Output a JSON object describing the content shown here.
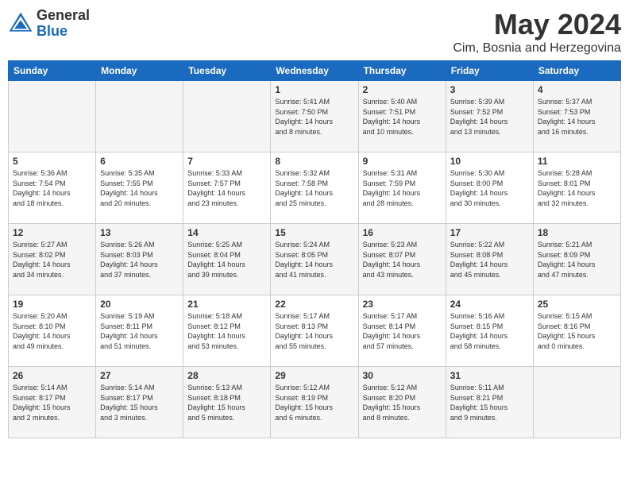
{
  "header": {
    "logo_general": "General",
    "logo_blue": "Blue",
    "month_title": "May 2024",
    "location": "Cim, Bosnia and Herzegovina"
  },
  "days_of_week": [
    "Sunday",
    "Monday",
    "Tuesday",
    "Wednesday",
    "Thursday",
    "Friday",
    "Saturday"
  ],
  "weeks": [
    [
      {
        "day": "",
        "info": ""
      },
      {
        "day": "",
        "info": ""
      },
      {
        "day": "",
        "info": ""
      },
      {
        "day": "1",
        "info": "Sunrise: 5:41 AM\nSunset: 7:50 PM\nDaylight: 14 hours\nand 8 minutes."
      },
      {
        "day": "2",
        "info": "Sunrise: 5:40 AM\nSunset: 7:51 PM\nDaylight: 14 hours\nand 10 minutes."
      },
      {
        "day": "3",
        "info": "Sunrise: 5:39 AM\nSunset: 7:52 PM\nDaylight: 14 hours\nand 13 minutes."
      },
      {
        "day": "4",
        "info": "Sunrise: 5:37 AM\nSunset: 7:53 PM\nDaylight: 14 hours\nand 16 minutes."
      }
    ],
    [
      {
        "day": "5",
        "info": "Sunrise: 5:36 AM\nSunset: 7:54 PM\nDaylight: 14 hours\nand 18 minutes."
      },
      {
        "day": "6",
        "info": "Sunrise: 5:35 AM\nSunset: 7:55 PM\nDaylight: 14 hours\nand 20 minutes."
      },
      {
        "day": "7",
        "info": "Sunrise: 5:33 AM\nSunset: 7:57 PM\nDaylight: 14 hours\nand 23 minutes."
      },
      {
        "day": "8",
        "info": "Sunrise: 5:32 AM\nSunset: 7:58 PM\nDaylight: 14 hours\nand 25 minutes."
      },
      {
        "day": "9",
        "info": "Sunrise: 5:31 AM\nSunset: 7:59 PM\nDaylight: 14 hours\nand 28 minutes."
      },
      {
        "day": "10",
        "info": "Sunrise: 5:30 AM\nSunset: 8:00 PM\nDaylight: 14 hours\nand 30 minutes."
      },
      {
        "day": "11",
        "info": "Sunrise: 5:28 AM\nSunset: 8:01 PM\nDaylight: 14 hours\nand 32 minutes."
      }
    ],
    [
      {
        "day": "12",
        "info": "Sunrise: 5:27 AM\nSunset: 8:02 PM\nDaylight: 14 hours\nand 34 minutes."
      },
      {
        "day": "13",
        "info": "Sunrise: 5:26 AM\nSunset: 8:03 PM\nDaylight: 14 hours\nand 37 minutes."
      },
      {
        "day": "14",
        "info": "Sunrise: 5:25 AM\nSunset: 8:04 PM\nDaylight: 14 hours\nand 39 minutes."
      },
      {
        "day": "15",
        "info": "Sunrise: 5:24 AM\nSunset: 8:05 PM\nDaylight: 14 hours\nand 41 minutes."
      },
      {
        "day": "16",
        "info": "Sunrise: 5:23 AM\nSunset: 8:07 PM\nDaylight: 14 hours\nand 43 minutes."
      },
      {
        "day": "17",
        "info": "Sunrise: 5:22 AM\nSunset: 8:08 PM\nDaylight: 14 hours\nand 45 minutes."
      },
      {
        "day": "18",
        "info": "Sunrise: 5:21 AM\nSunset: 8:09 PM\nDaylight: 14 hours\nand 47 minutes."
      }
    ],
    [
      {
        "day": "19",
        "info": "Sunrise: 5:20 AM\nSunset: 8:10 PM\nDaylight: 14 hours\nand 49 minutes."
      },
      {
        "day": "20",
        "info": "Sunrise: 5:19 AM\nSunset: 8:11 PM\nDaylight: 14 hours\nand 51 minutes."
      },
      {
        "day": "21",
        "info": "Sunrise: 5:18 AM\nSunset: 8:12 PM\nDaylight: 14 hours\nand 53 minutes."
      },
      {
        "day": "22",
        "info": "Sunrise: 5:17 AM\nSunset: 8:13 PM\nDaylight: 14 hours\nand 55 minutes."
      },
      {
        "day": "23",
        "info": "Sunrise: 5:17 AM\nSunset: 8:14 PM\nDaylight: 14 hours\nand 57 minutes."
      },
      {
        "day": "24",
        "info": "Sunrise: 5:16 AM\nSunset: 8:15 PM\nDaylight: 14 hours\nand 58 minutes."
      },
      {
        "day": "25",
        "info": "Sunrise: 5:15 AM\nSunset: 8:16 PM\nDaylight: 15 hours\nand 0 minutes."
      }
    ],
    [
      {
        "day": "26",
        "info": "Sunrise: 5:14 AM\nSunset: 8:17 PM\nDaylight: 15 hours\nand 2 minutes."
      },
      {
        "day": "27",
        "info": "Sunrise: 5:14 AM\nSunset: 8:17 PM\nDaylight: 15 hours\nand 3 minutes."
      },
      {
        "day": "28",
        "info": "Sunrise: 5:13 AM\nSunset: 8:18 PM\nDaylight: 15 hours\nand 5 minutes."
      },
      {
        "day": "29",
        "info": "Sunrise: 5:12 AM\nSunset: 8:19 PM\nDaylight: 15 hours\nand 6 minutes."
      },
      {
        "day": "30",
        "info": "Sunrise: 5:12 AM\nSunset: 8:20 PM\nDaylight: 15 hours\nand 8 minutes."
      },
      {
        "day": "31",
        "info": "Sunrise: 5:11 AM\nSunset: 8:21 PM\nDaylight: 15 hours\nand 9 minutes."
      },
      {
        "day": "",
        "info": ""
      }
    ]
  ]
}
